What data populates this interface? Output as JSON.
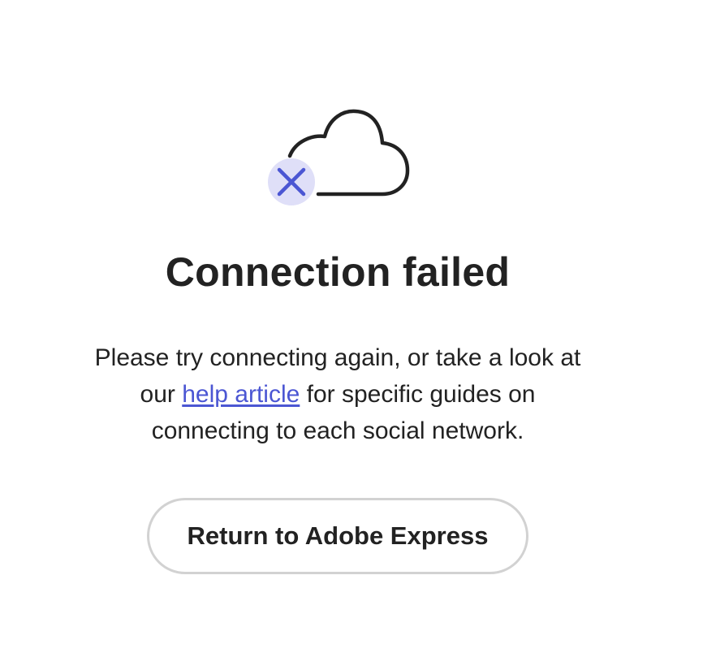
{
  "status": {
    "heading": "Connection failed",
    "message_line1": "Please try connecting again, or take a look at",
    "message_line2_prefix": "our ",
    "help_link_text": "help article",
    "message_line2_suffix": " for specific guides on",
    "message_line3": "connecting to each social network."
  },
  "actions": {
    "return_label": "Return to Adobe Express"
  },
  "icons": {
    "illustration": "cloud-icon",
    "error_badge": "close-icon"
  },
  "colors": {
    "accent": "#4b56d3",
    "badge_background": "#dfdff8",
    "text": "#222222",
    "button_border": "#d2d2d2"
  }
}
